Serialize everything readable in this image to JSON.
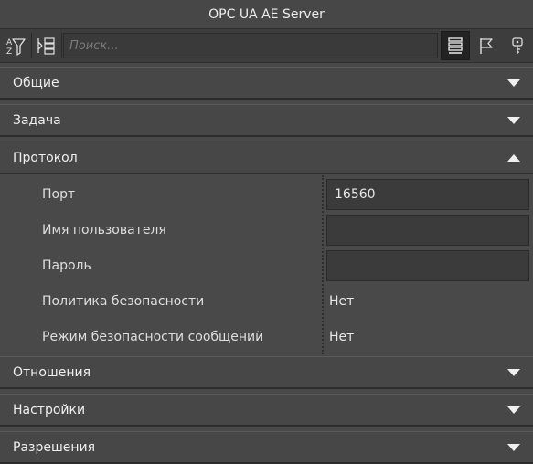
{
  "window": {
    "title": "OPC UA AE Server"
  },
  "toolbar": {
    "search_placeholder": "Поиск...",
    "icons": [
      "sort-filter-icon",
      "collapse-tree-icon",
      "list-view-icon",
      "flag-icon",
      "key-icon"
    ]
  },
  "sections": {
    "general": {
      "label": "Общие",
      "expanded": false
    },
    "task": {
      "label": "Задача",
      "expanded": false
    },
    "protocol": {
      "label": "Протокол",
      "expanded": true
    },
    "relations": {
      "label": "Отношения",
      "expanded": false
    },
    "settings": {
      "label": "Настройки",
      "expanded": false
    },
    "permissions": {
      "label": "Разрешения",
      "expanded": false
    }
  },
  "protocol": {
    "port": {
      "label": "Порт",
      "value": "16560"
    },
    "username": {
      "label": "Имя пользователя",
      "value": ""
    },
    "password": {
      "label": "Пароль",
      "value": ""
    },
    "security_policy": {
      "label": "Политика безопасности",
      "value": "Нет"
    },
    "message_security_mode": {
      "label": "Режим безопасности сообщений",
      "value": "Нет"
    }
  },
  "colors": {
    "background": "#494949",
    "header": "#474747",
    "toolbar": "#3d3d3d",
    "input": "#3b3b3b",
    "text": "#e6e6e6"
  }
}
